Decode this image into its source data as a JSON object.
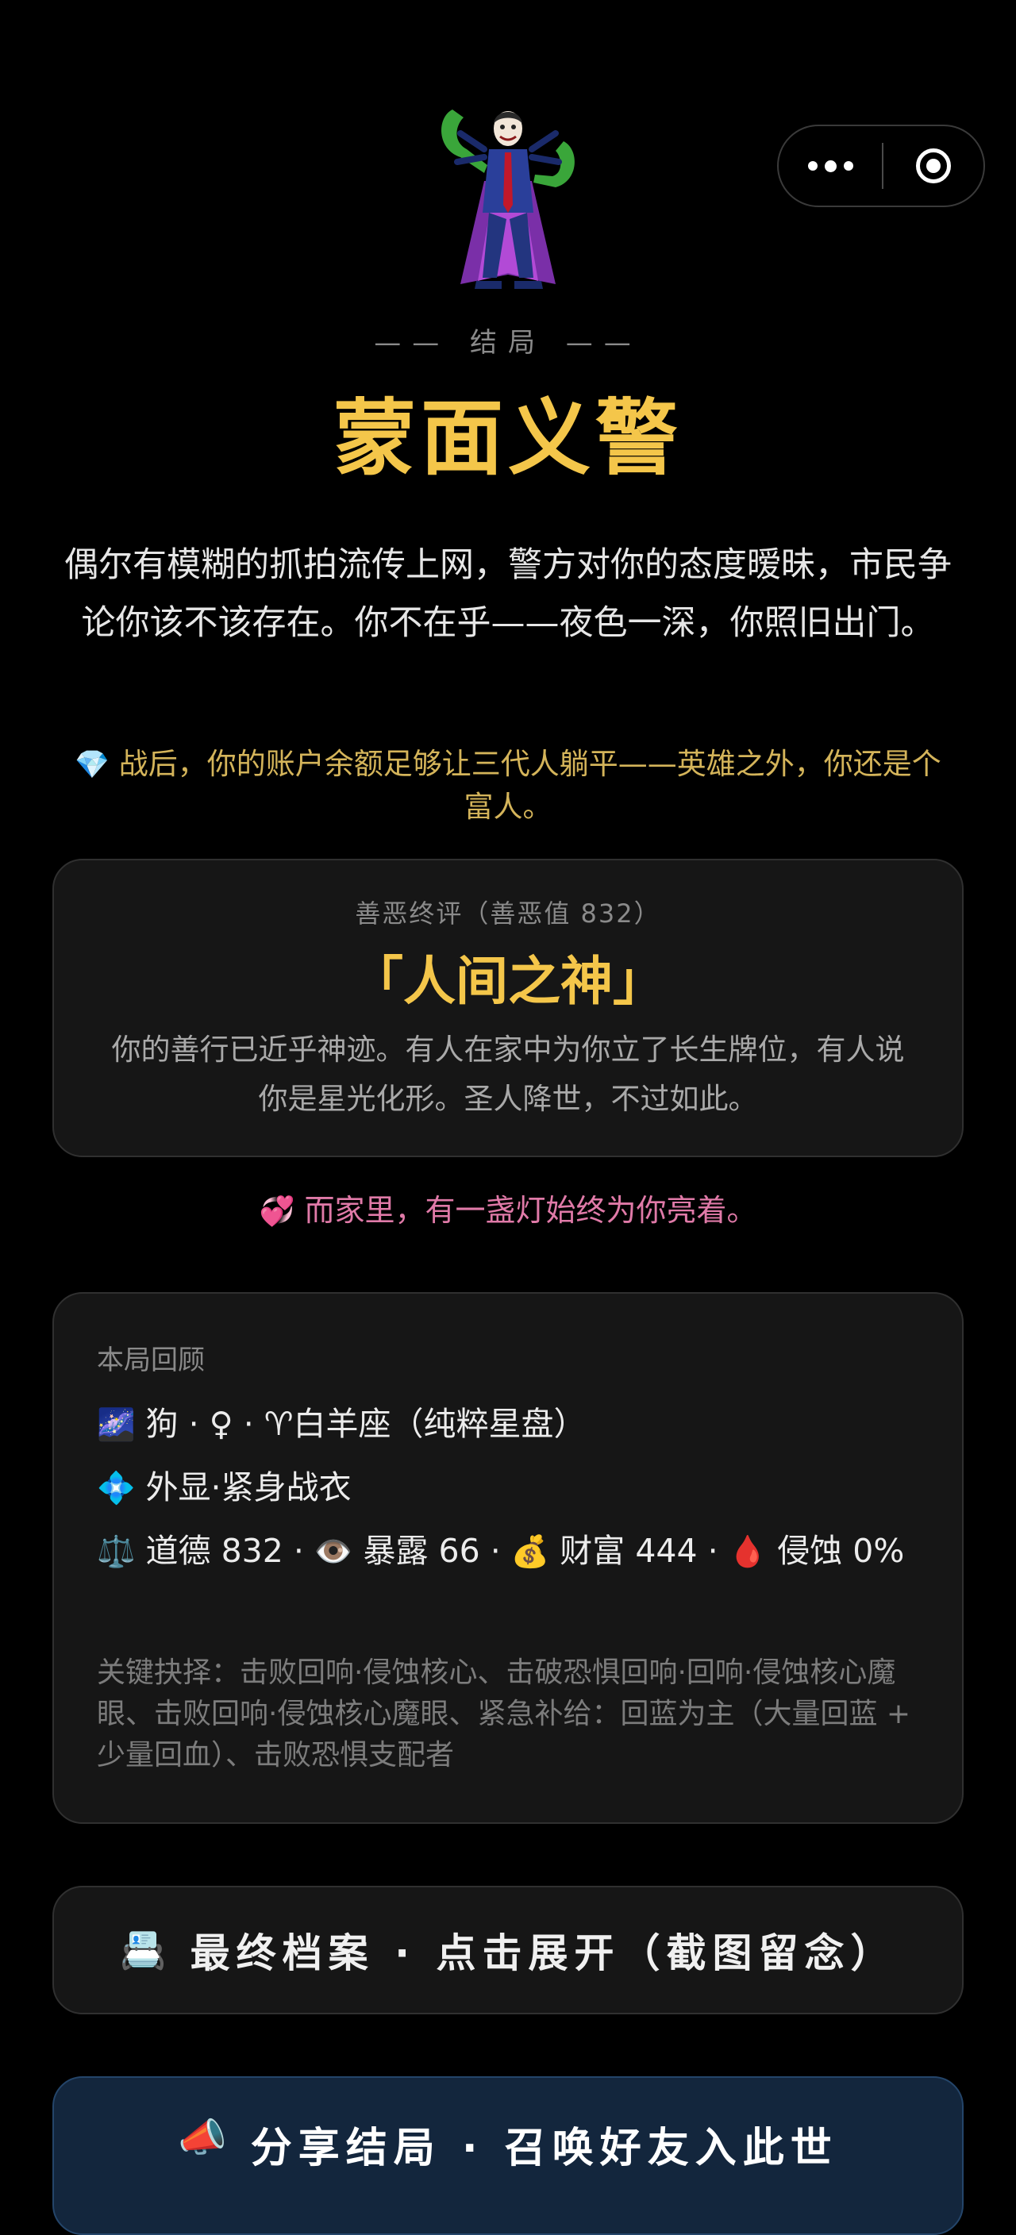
{
  "capsule": {
    "more_icon": "more-dots-icon",
    "close_icon": "target-close-icon"
  },
  "hero": {
    "icon": "caped-villain-figure"
  },
  "ending": {
    "label": "—— 结局 ——",
    "title": "蒙面义警",
    "description": "偶尔有模糊的抓拍流传上网，警方对你的态度暧昧，市民争论你该不该存在。你不在乎——夜色一深，你照旧出门。",
    "wealth_emoji": "💎",
    "wealth_text": "战后，你的账户余额足够让三代人躺平——英雄之外，你还是个富人。"
  },
  "verdict": {
    "caption": "善恶终评（善恶值 832）",
    "title": "「人间之神」",
    "description": "你的善行已近乎神迹。有人在家中为你立了长生牌位，有人说你是星光化形。圣人降世，不过如此。"
  },
  "family": {
    "emoji": "💞",
    "text": "而家里，有一盏灯始终为你亮着。"
  },
  "recap": {
    "caption": "本局回顾",
    "row1_emoji": "🌌",
    "row1_text": "狗 · ♀ · ♈白羊座（纯粹星盘）",
    "row2_emoji": "💠",
    "row2_text": "外显·紧身战衣",
    "row3_emoji_1": "⚖️",
    "row3_text_1": "道德 832 · ",
    "row3_emoji_2": "👁️",
    "row3_text_2": "暴露 66 · ",
    "row3_emoji_3": "💰",
    "row3_text_3": "财富 444 · ",
    "row3_emoji_4": "🩸",
    "row3_text_4": "侵蚀 0%",
    "key_choices": "关键抉择：击败回响·侵蚀核心、击破恐惧回响·回响·侵蚀核心魔眼、击败回响·侵蚀核心魔眼、紧急补给：回蓝为主（大量回蓝 + 少量回血）、击败恐惧支配者"
  },
  "buttons": {
    "archive_emoji": "📇",
    "archive_label": "最终档案 · 点击展开（截图留念）",
    "share_emoji": "📣",
    "share_label": "分享结局 · 召唤好友入此世"
  }
}
